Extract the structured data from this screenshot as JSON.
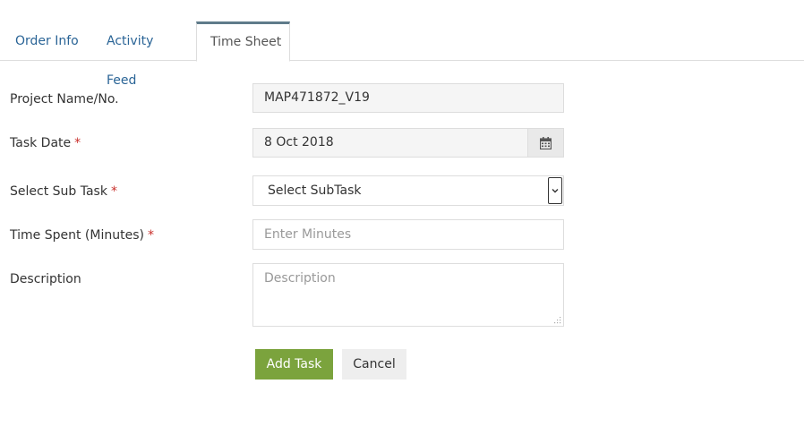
{
  "tabs": [
    {
      "label": "Order Info"
    },
    {
      "label": "Activity Feed"
    },
    {
      "label": "Time Sheet"
    }
  ],
  "form": {
    "project": {
      "label": "Project Name/No.",
      "value": "MAP471872_V19"
    },
    "task_date": {
      "label": "Task Date",
      "required_mark": "*",
      "value": "8 Oct 2018",
      "icon": "calendar-icon"
    },
    "sub_task": {
      "label": "Select Sub Task",
      "required_mark": "*",
      "selected": "Select SubTask"
    },
    "time_spent": {
      "label": "Time Spent (Minutes)",
      "required_mark": "*",
      "placeholder": "Enter Minutes"
    },
    "description": {
      "label": "Description",
      "placeholder": "Description"
    }
  },
  "buttons": {
    "add_task": "Add Task",
    "cancel": "Cancel"
  },
  "colors": {
    "accent_green": "#7ba33d",
    "tab_link": "#2a6496",
    "required": "#c9302c"
  }
}
